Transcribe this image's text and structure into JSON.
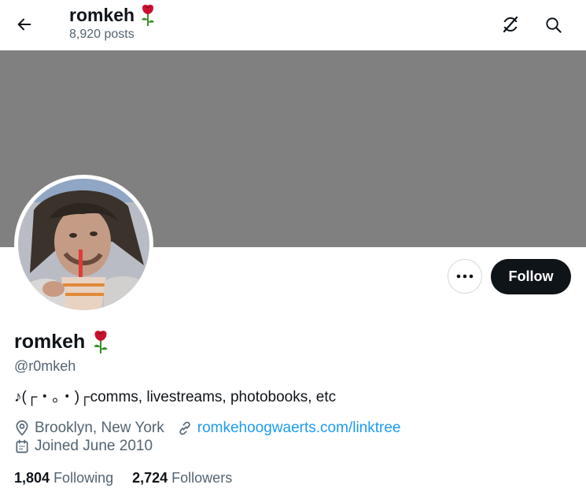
{
  "header": {
    "name": "romkeh",
    "posts_count": "8,920",
    "posts_label": "posts"
  },
  "profile": {
    "display_name": "romkeh",
    "handle": "@r0mkeh",
    "bio": "♪(┌・。・)┌comms, livestreams, photobooks, etc",
    "location": "Brooklyn, New York",
    "website": "romkehoogwaerts.com/linktree",
    "joined": "Joined June 2010"
  },
  "actions": {
    "follow_label": "Follow"
  },
  "stats": {
    "following_count": "1,804",
    "following_label": "Following",
    "followers_count": "2,724",
    "followers_label": "Followers"
  },
  "icons": {
    "back": "arrow-left-icon",
    "grok": "grok-icon",
    "search": "search-icon",
    "more": "more-horizontal-icon",
    "location": "location-pin-icon",
    "link": "link-icon",
    "calendar": "calendar-icon",
    "name_emoji": "rose-icon"
  },
  "colors": {
    "banner": "#808080",
    "link": "#1d9bf0",
    "secondary_text": "#536471",
    "follow_bg": "#0f1419"
  }
}
